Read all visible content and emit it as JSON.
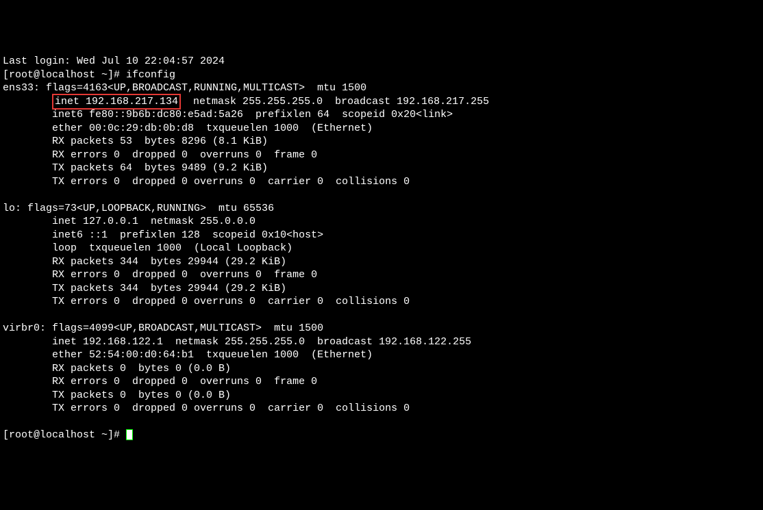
{
  "prompt1": "[root@localhost ~]# ",
  "cmd": "ifconfig",
  "prompt2": "[root@localhost ~]# ",
  "lines": {
    "l0": "Last login: Wed Jul 10 22:04:57 2024",
    "ens_hdr": "ens33: flags=4163<UP,BROADCAST,RUNNING,MULTICAST>  mtu 1500",
    "ens_inet_pad": "        ",
    "ens_inet_hl": "inet 192.168.217.134",
    "ens_inet_rest": "  netmask 255.255.255.0  broadcast 192.168.217.255",
    "ens_inet6": "        inet6 fe80::9b6b:dc80:e5ad:5a26  prefixlen 64  scopeid 0x20<link>",
    "ens_ether": "        ether 00:0c:29:db:0b:d8  txqueuelen 1000  (Ethernet)",
    "ens_rx_pkt": "        RX packets 53  bytes 8296 (8.1 KiB)",
    "ens_rx_err": "        RX errors 0  dropped 0  overruns 0  frame 0",
    "ens_tx_pkt": "        TX packets 64  bytes 9489 (9.2 KiB)",
    "ens_tx_err": "        TX errors 0  dropped 0 overruns 0  carrier 0  collisions 0",
    "blank": "",
    "lo_hdr": "lo: flags=73<UP,LOOPBACK,RUNNING>  mtu 65536",
    "lo_inet": "        inet 127.0.0.1  netmask 255.0.0.0",
    "lo_inet6": "        inet6 ::1  prefixlen 128  scopeid 0x10<host>",
    "lo_loop": "        loop  txqueuelen 1000  (Local Loopback)",
    "lo_rx_pkt": "        RX packets 344  bytes 29944 (29.2 KiB)",
    "lo_rx_err": "        RX errors 0  dropped 0  overruns 0  frame 0",
    "lo_tx_pkt": "        TX packets 344  bytes 29944 (29.2 KiB)",
    "lo_tx_err": "        TX errors 0  dropped 0 overruns 0  carrier 0  collisions 0",
    "vb_hdr": "virbr0: flags=4099<UP,BROADCAST,MULTICAST>  mtu 1500",
    "vb_inet": "        inet 192.168.122.1  netmask 255.255.255.0  broadcast 192.168.122.255",
    "vb_ether": "        ether 52:54:00:d0:64:b1  txqueuelen 1000  (Ethernet)",
    "vb_rx_pkt": "        RX packets 0  bytes 0 (0.0 B)",
    "vb_rx_err": "        RX errors 0  dropped 0  overruns 0  frame 0",
    "vb_tx_pkt": "        TX packets 0  bytes 0 (0.0 B)",
    "vb_tx_err": "        TX errors 0  dropped 0 overruns 0  carrier 0  collisions 0"
  }
}
